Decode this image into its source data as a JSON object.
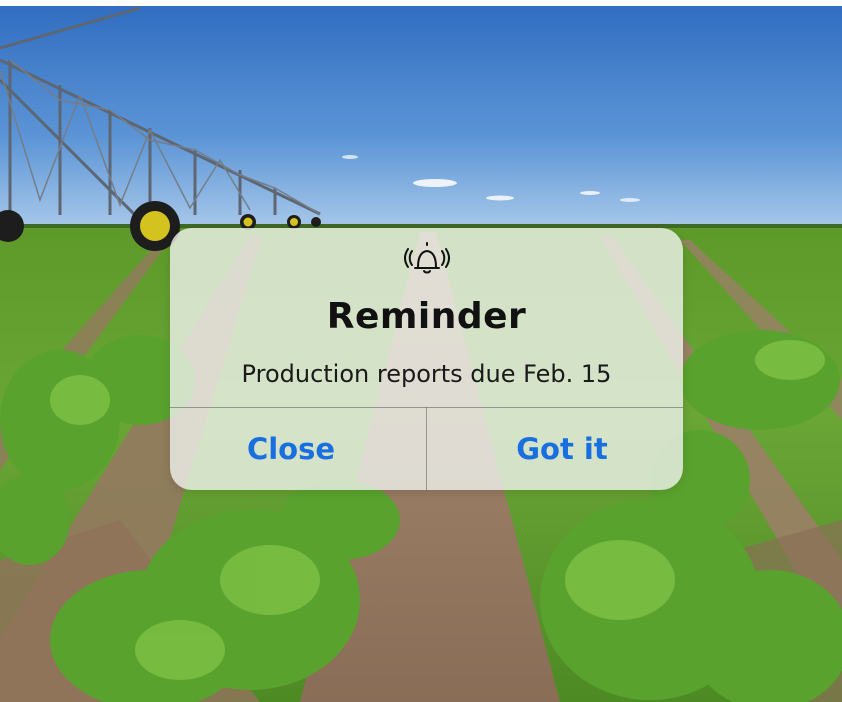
{
  "background": {
    "description_icon": "farm-field-irrigation-photo"
  },
  "alert": {
    "icon": "bell-ringing-icon",
    "title": "Reminder",
    "message": "Production reports due Feb. 15",
    "buttons": {
      "close_label": "Close",
      "ok_label": "Got it"
    },
    "colors": {
      "button_text": "#1a6fe0",
      "title_text": "#111111"
    }
  }
}
